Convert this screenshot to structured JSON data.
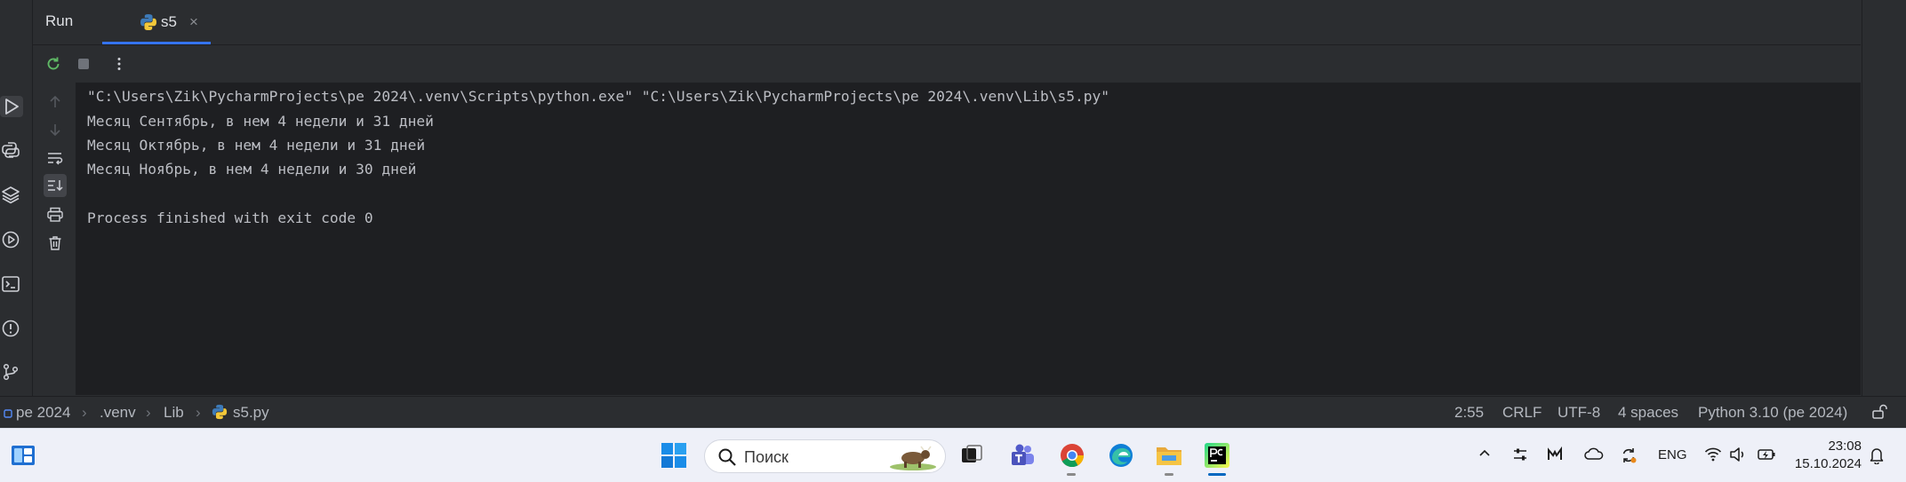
{
  "toolwindow": {
    "title": "Run",
    "tab": {
      "label": "s5",
      "close": "×"
    }
  },
  "console": {
    "lines": [
      "\"C:\\Users\\Zik\\PycharmProjects\\pe 2024\\.venv\\Scripts\\python.exe\" \"C:\\Users\\Zik\\PycharmProjects\\pe 2024\\.venv\\Lib\\s5.py\"",
      "Месяц Сентябрь, в нем 4 недели и 31 дней",
      "Месяц Октябрь, в нем 4 недели и 31 дней",
      "Месяц Ноябрь, в нем 4 недели и 30 дней",
      "",
      "Process finished with exit code 0"
    ]
  },
  "statusbar": {
    "breadcrumb": [
      "pe 2024",
      ".venv",
      "Lib",
      "s5.py"
    ],
    "position": "2:55",
    "line_separator": "CRLF",
    "encoding": "UTF-8",
    "indent": "4 spaces",
    "interpreter": "Python 3.10 (pe 2024)"
  },
  "taskbar": {
    "search_placeholder": "Поиск",
    "language": "ENG",
    "time": "23:08",
    "date": "15.10.2024"
  },
  "colors": {
    "ide_bg": "#2b2d30",
    "console_bg": "#1e1f22",
    "console_text": "#bcbec4",
    "accent": "#3574f0",
    "taskbar_bg": "#eef0f8"
  },
  "icons": {
    "leftbar": [
      "run-icon",
      "python-console-icon",
      "layers-icon",
      "services-icon",
      "terminal-icon",
      "problems-icon",
      "git-icon"
    ],
    "toolbar": [
      "rerun-icon",
      "stop-icon",
      "more-icon"
    ],
    "gutter": [
      "scroll-up-icon",
      "scroll-down-icon",
      "soft-wrap-icon",
      "scroll-to-end-icon",
      "print-icon",
      "clear-icon"
    ]
  }
}
